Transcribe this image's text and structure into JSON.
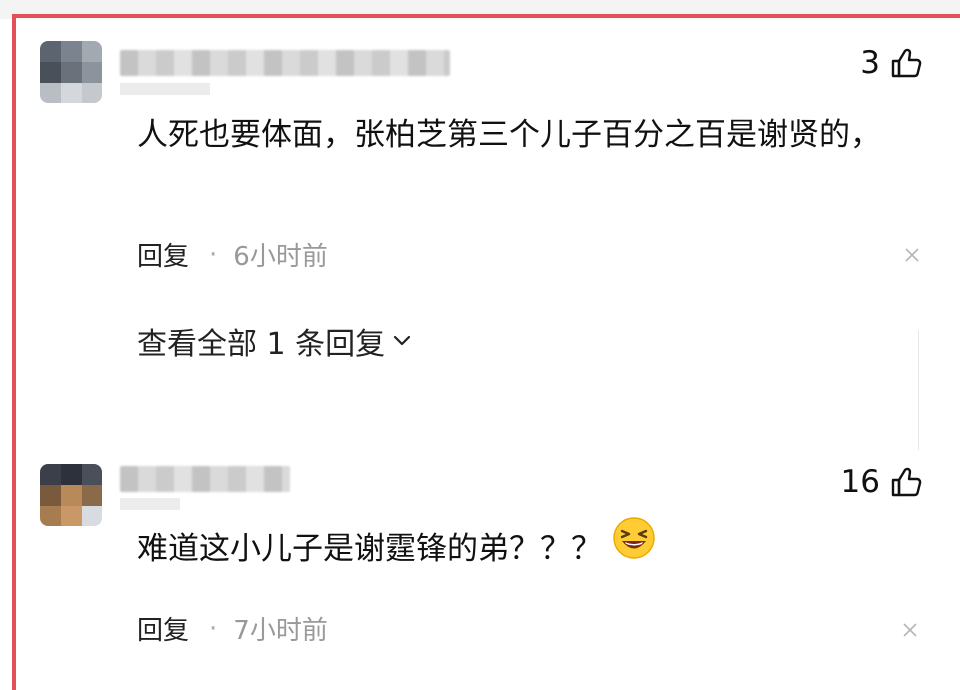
{
  "comments": [
    {
      "likes": "3",
      "text": "人死也要体面，张柏芝第三个儿子百分之百是谢贤的，",
      "reply_label": "回复",
      "separator": "·",
      "time": "6小时前",
      "view_replies": "查看全部 1 条回复"
    },
    {
      "likes": "16",
      "text": "难道这小儿子是谢霆锋的弟？？？",
      "reply_label": "回复",
      "separator": "·",
      "time": "7小时前",
      "emoji": "laughing-face-emoji"
    }
  ],
  "colors": {
    "highlight_border": "#e4505a",
    "meta_text": "#999999"
  }
}
